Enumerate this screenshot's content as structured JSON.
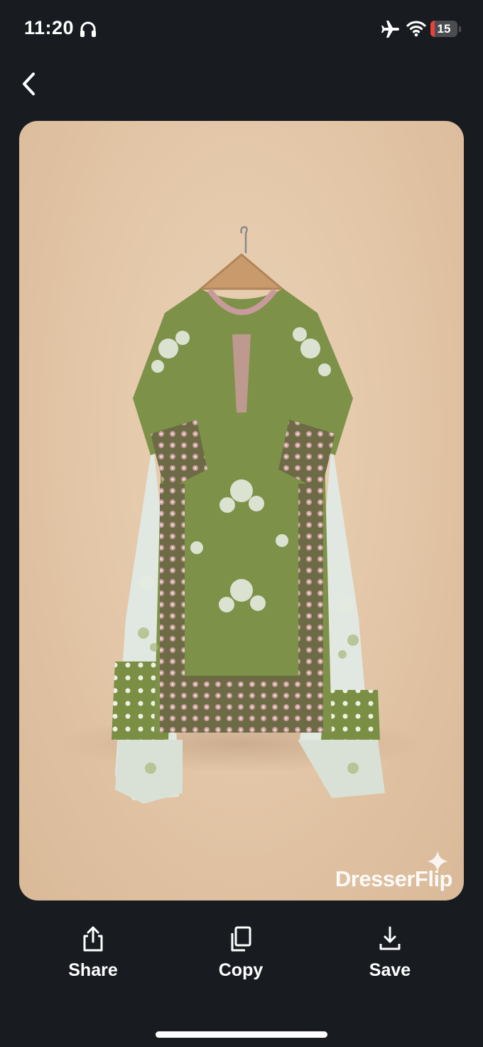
{
  "status_bar": {
    "time": "11:20",
    "battery_percent": "15",
    "battery_level": 0.15,
    "battery_color": "#e8413a",
    "icons": [
      "headphones-icon",
      "airplane-icon",
      "wifi-icon"
    ]
  },
  "nav": {
    "back_icon": "chevron-left-icon"
  },
  "photo": {
    "background": "#e2c5a6",
    "watermark": "DresserFlip"
  },
  "actions": [
    {
      "label": "Share",
      "icon": "share-icon"
    },
    {
      "label": "Copy",
      "icon": "copy-icon"
    },
    {
      "label": "Save",
      "icon": "download-icon"
    }
  ]
}
